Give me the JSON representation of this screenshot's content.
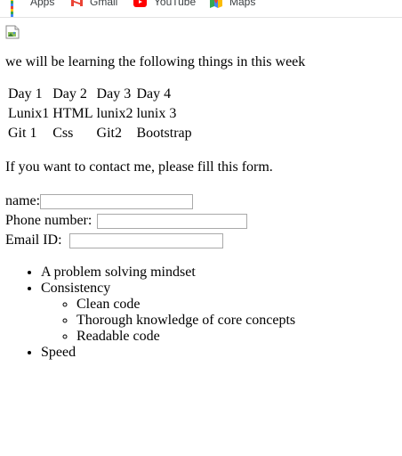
{
  "bookmarks": [
    {
      "label": "Apps",
      "icon": "apps-grid-icon"
    },
    {
      "label": "Gmail",
      "icon": "gmail-icon"
    },
    {
      "label": "YouTube",
      "icon": "youtube-icon"
    },
    {
      "label": "Maps",
      "icon": "maps-icon"
    }
  ],
  "page": {
    "image_icon": "broken-image-icon",
    "intro": "we will be learning the following things in this week",
    "schedule": {
      "rows": [
        [
          "Day 1",
          "Day 2",
          "Day 3",
          "Day 4"
        ],
        [
          "Lunix1",
          "HTML",
          "lunix2",
          "lunix 3"
        ],
        [
          "Git 1",
          "Css",
          "Git2",
          "Bootstrap"
        ]
      ]
    },
    "contact_text": "If you want to contact me, please fill this form.",
    "form": {
      "name_label": "name:",
      "name_value": "",
      "phone_label": "Phone number:",
      "phone_value": "",
      "email_label": "Email ID:",
      "email_value": ""
    },
    "skills": {
      "items": [
        "A problem solving mindset",
        "Consistency",
        "Speed"
      ],
      "consistency_sub": [
        "Clean code",
        "Thorough knowledge of core concepts",
        "Readable code"
      ]
    }
  }
}
